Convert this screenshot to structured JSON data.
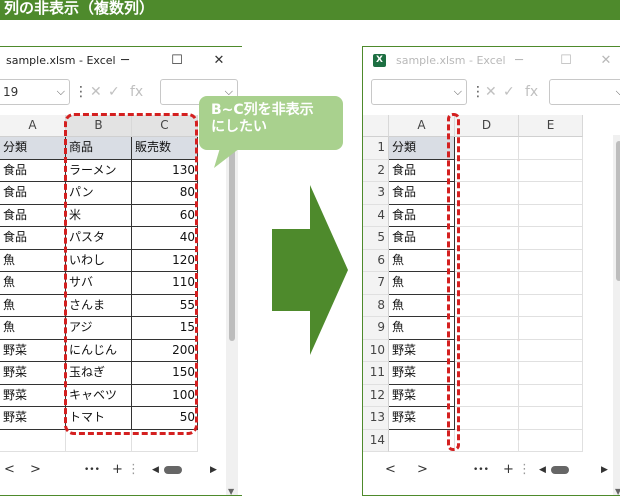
{
  "banner": {
    "title": "列の非表示（複数列）"
  },
  "left_window": {
    "title": "sample.xlsm - Excel",
    "controls": {
      "minimize": "─",
      "maximize": "☐",
      "close": "✕"
    },
    "name_box": "19",
    "columns": [
      "A",
      "B",
      "C"
    ],
    "table": {
      "headers": [
        "分類",
        "商品",
        "販売数"
      ],
      "rows": [
        [
          "食品",
          "ラーメン",
          "130"
        ],
        [
          "食品",
          "パン",
          "80"
        ],
        [
          "食品",
          "米",
          "60"
        ],
        [
          "食品",
          "パスタ",
          "40"
        ],
        [
          "魚",
          "いわし",
          "120"
        ],
        [
          "魚",
          "サバ",
          "110"
        ],
        [
          "魚",
          "さんま",
          "55"
        ],
        [
          "魚",
          "アジ",
          "15"
        ],
        [
          "野菜",
          "にんじん",
          "200"
        ],
        [
          "野菜",
          "玉ねぎ",
          "150"
        ],
        [
          "野菜",
          "キャベツ",
          "100"
        ],
        [
          "野菜",
          "トマト",
          "50"
        ]
      ]
    },
    "bottom": {
      "prev": "<",
      "next": ">",
      "more": "•••",
      "add": "+",
      "sep": "⋮"
    }
  },
  "callout": {
    "line1": "B~C列を非表示",
    "line2": "にしたい"
  },
  "right_window": {
    "title": "sample.xlsm - Excel",
    "icon": "X",
    "controls": {
      "minimize": "─",
      "maximize": "☐",
      "close": "✕"
    },
    "columns": [
      "A",
      "D",
      "E"
    ],
    "row_numbers": [
      "1",
      "2",
      "3",
      "4",
      "5",
      "6",
      "7",
      "8",
      "9",
      "10",
      "11",
      "12",
      "13",
      "14"
    ],
    "col_a": [
      "分類",
      "食品",
      "食品",
      "食品",
      "食品",
      "魚",
      "魚",
      "魚",
      "魚",
      "野菜",
      "野菜",
      "野菜",
      "野菜",
      ""
    ],
    "bottom": {
      "prev": "<",
      "next": ">",
      "more": "•••",
      "add": "+",
      "sep": "⋮"
    }
  },
  "colors": {
    "banner": "#4e8a2c",
    "arrow": "#4e8a2c",
    "dash": "#d42020",
    "callout": "#a9d18e",
    "header_fill": "#d9dde4"
  }
}
